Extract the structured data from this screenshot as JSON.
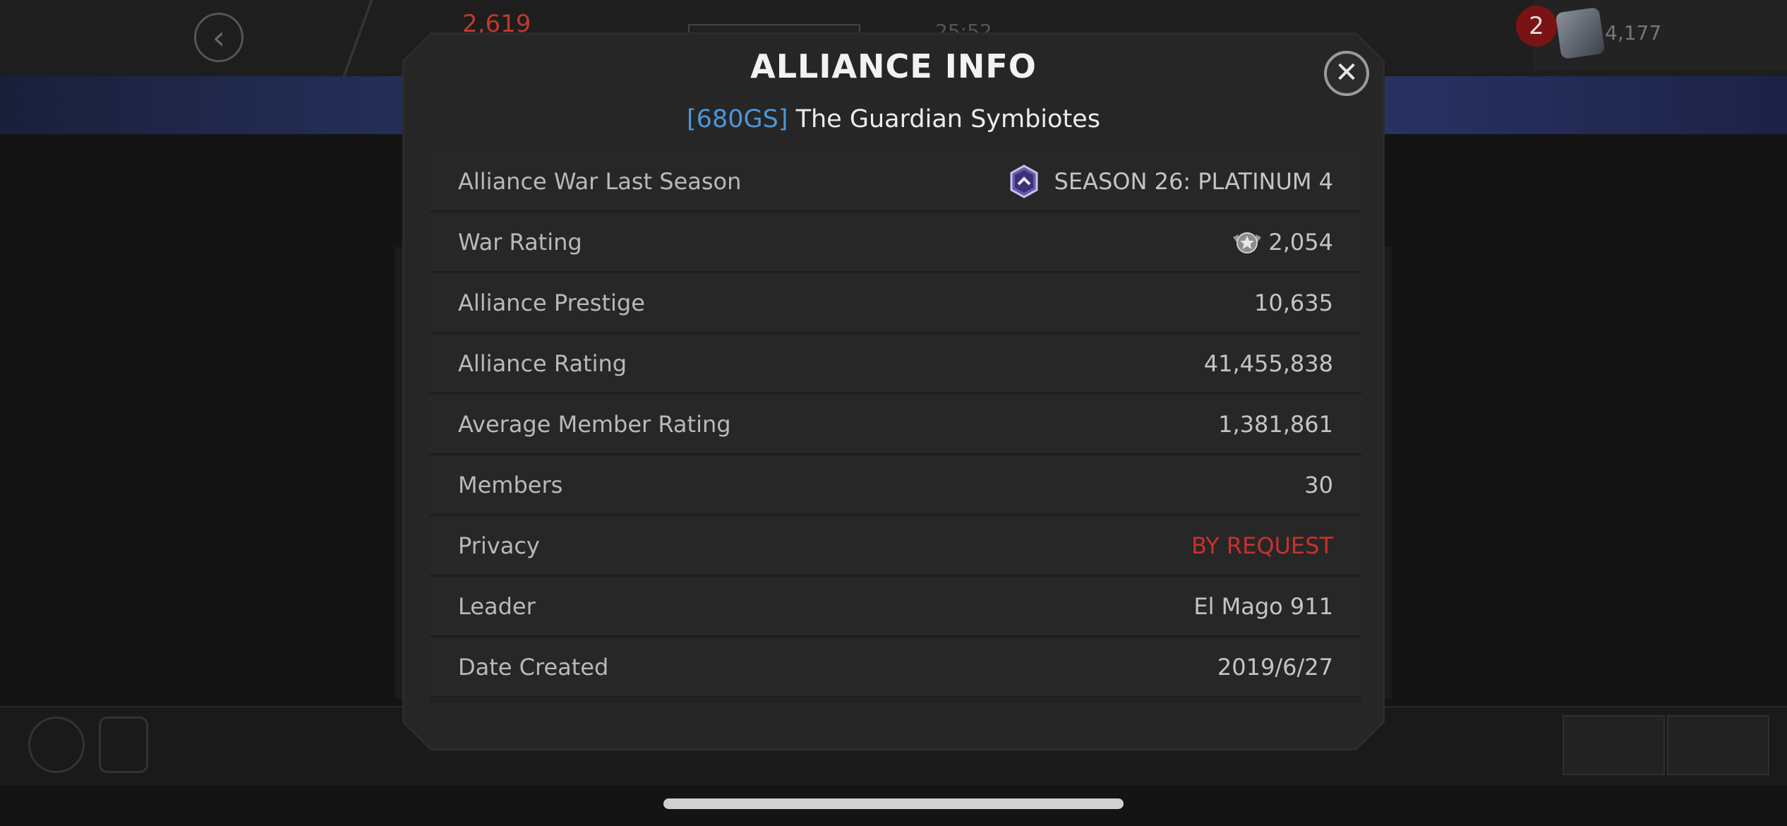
{
  "background": {
    "top_counter": "2,619",
    "top_timer": "25:52",
    "notification_count": "2",
    "units_value": "4,177"
  },
  "modal": {
    "title": "ALLIANCE INFO",
    "close_icon": "close-icon",
    "alliance_tag": "[680GS]",
    "alliance_name": "The Guardian Symbiotes",
    "rows": [
      {
        "label": "Alliance War Last Season",
        "value": "SEASON 26: PLATINUM 4",
        "icon": "platinum-season-icon"
      },
      {
        "label": "War Rating",
        "value": "2,054",
        "icon": "war-rating-icon"
      },
      {
        "label": "Alliance Prestige",
        "value": "10,635"
      },
      {
        "label": "Alliance Rating",
        "value": "41,455,838"
      },
      {
        "label": "Average Member Rating",
        "value": "1,381,861"
      },
      {
        "label": "Members",
        "value": "30"
      },
      {
        "label": "Privacy",
        "value": "BY REQUEST",
        "color": "#c9302c"
      },
      {
        "label": "Leader",
        "value": "El Mago 911"
      },
      {
        "label": "Date Created",
        "value": "2019/6/27"
      }
    ]
  },
  "colors": {
    "tag_blue": "#4e95d8",
    "privacy_red": "#c9302c",
    "modal_bg": "#262626"
  }
}
